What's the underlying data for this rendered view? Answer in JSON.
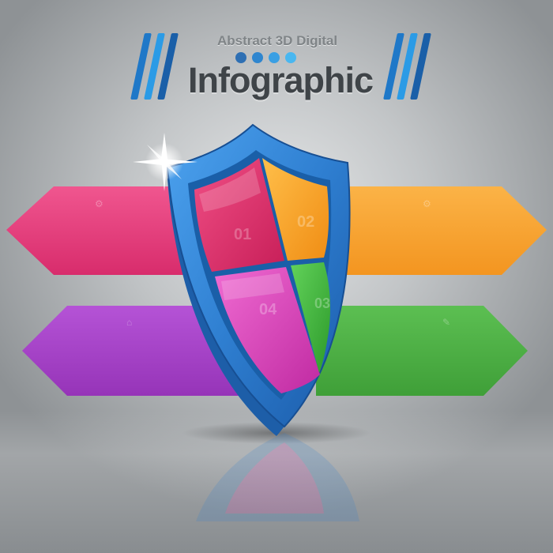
{
  "header": {
    "subtitle": "Abstract 3D Digital",
    "title": "Infographic",
    "dot_colors": [
      "#2e6fb3",
      "#2f86cf",
      "#3a9fe3",
      "#49b7f0"
    ],
    "stripe_colors": [
      "#1f78c8",
      "#2b9be6",
      "#1a5fa8"
    ]
  },
  "banners": [
    {
      "id": "pink",
      "color": "#e93d7c",
      "title": "",
      "text": ""
    },
    {
      "id": "orange",
      "color": "#f7a22b",
      "title": "",
      "text": ""
    },
    {
      "id": "purple",
      "color": "#a73fc8",
      "title": "",
      "text": ""
    },
    {
      "id": "green",
      "color": "#4caf44",
      "title": "",
      "text": ""
    }
  ],
  "shield": {
    "frame_color": "#2f7fd1",
    "quadrants": [
      {
        "number": "01",
        "color": "#e2306a"
      },
      {
        "number": "02",
        "color": "#f6a322"
      },
      {
        "number": "04",
        "color": "#d73bb8"
      },
      {
        "number": "03",
        "color": "#39b13a"
      }
    ]
  }
}
